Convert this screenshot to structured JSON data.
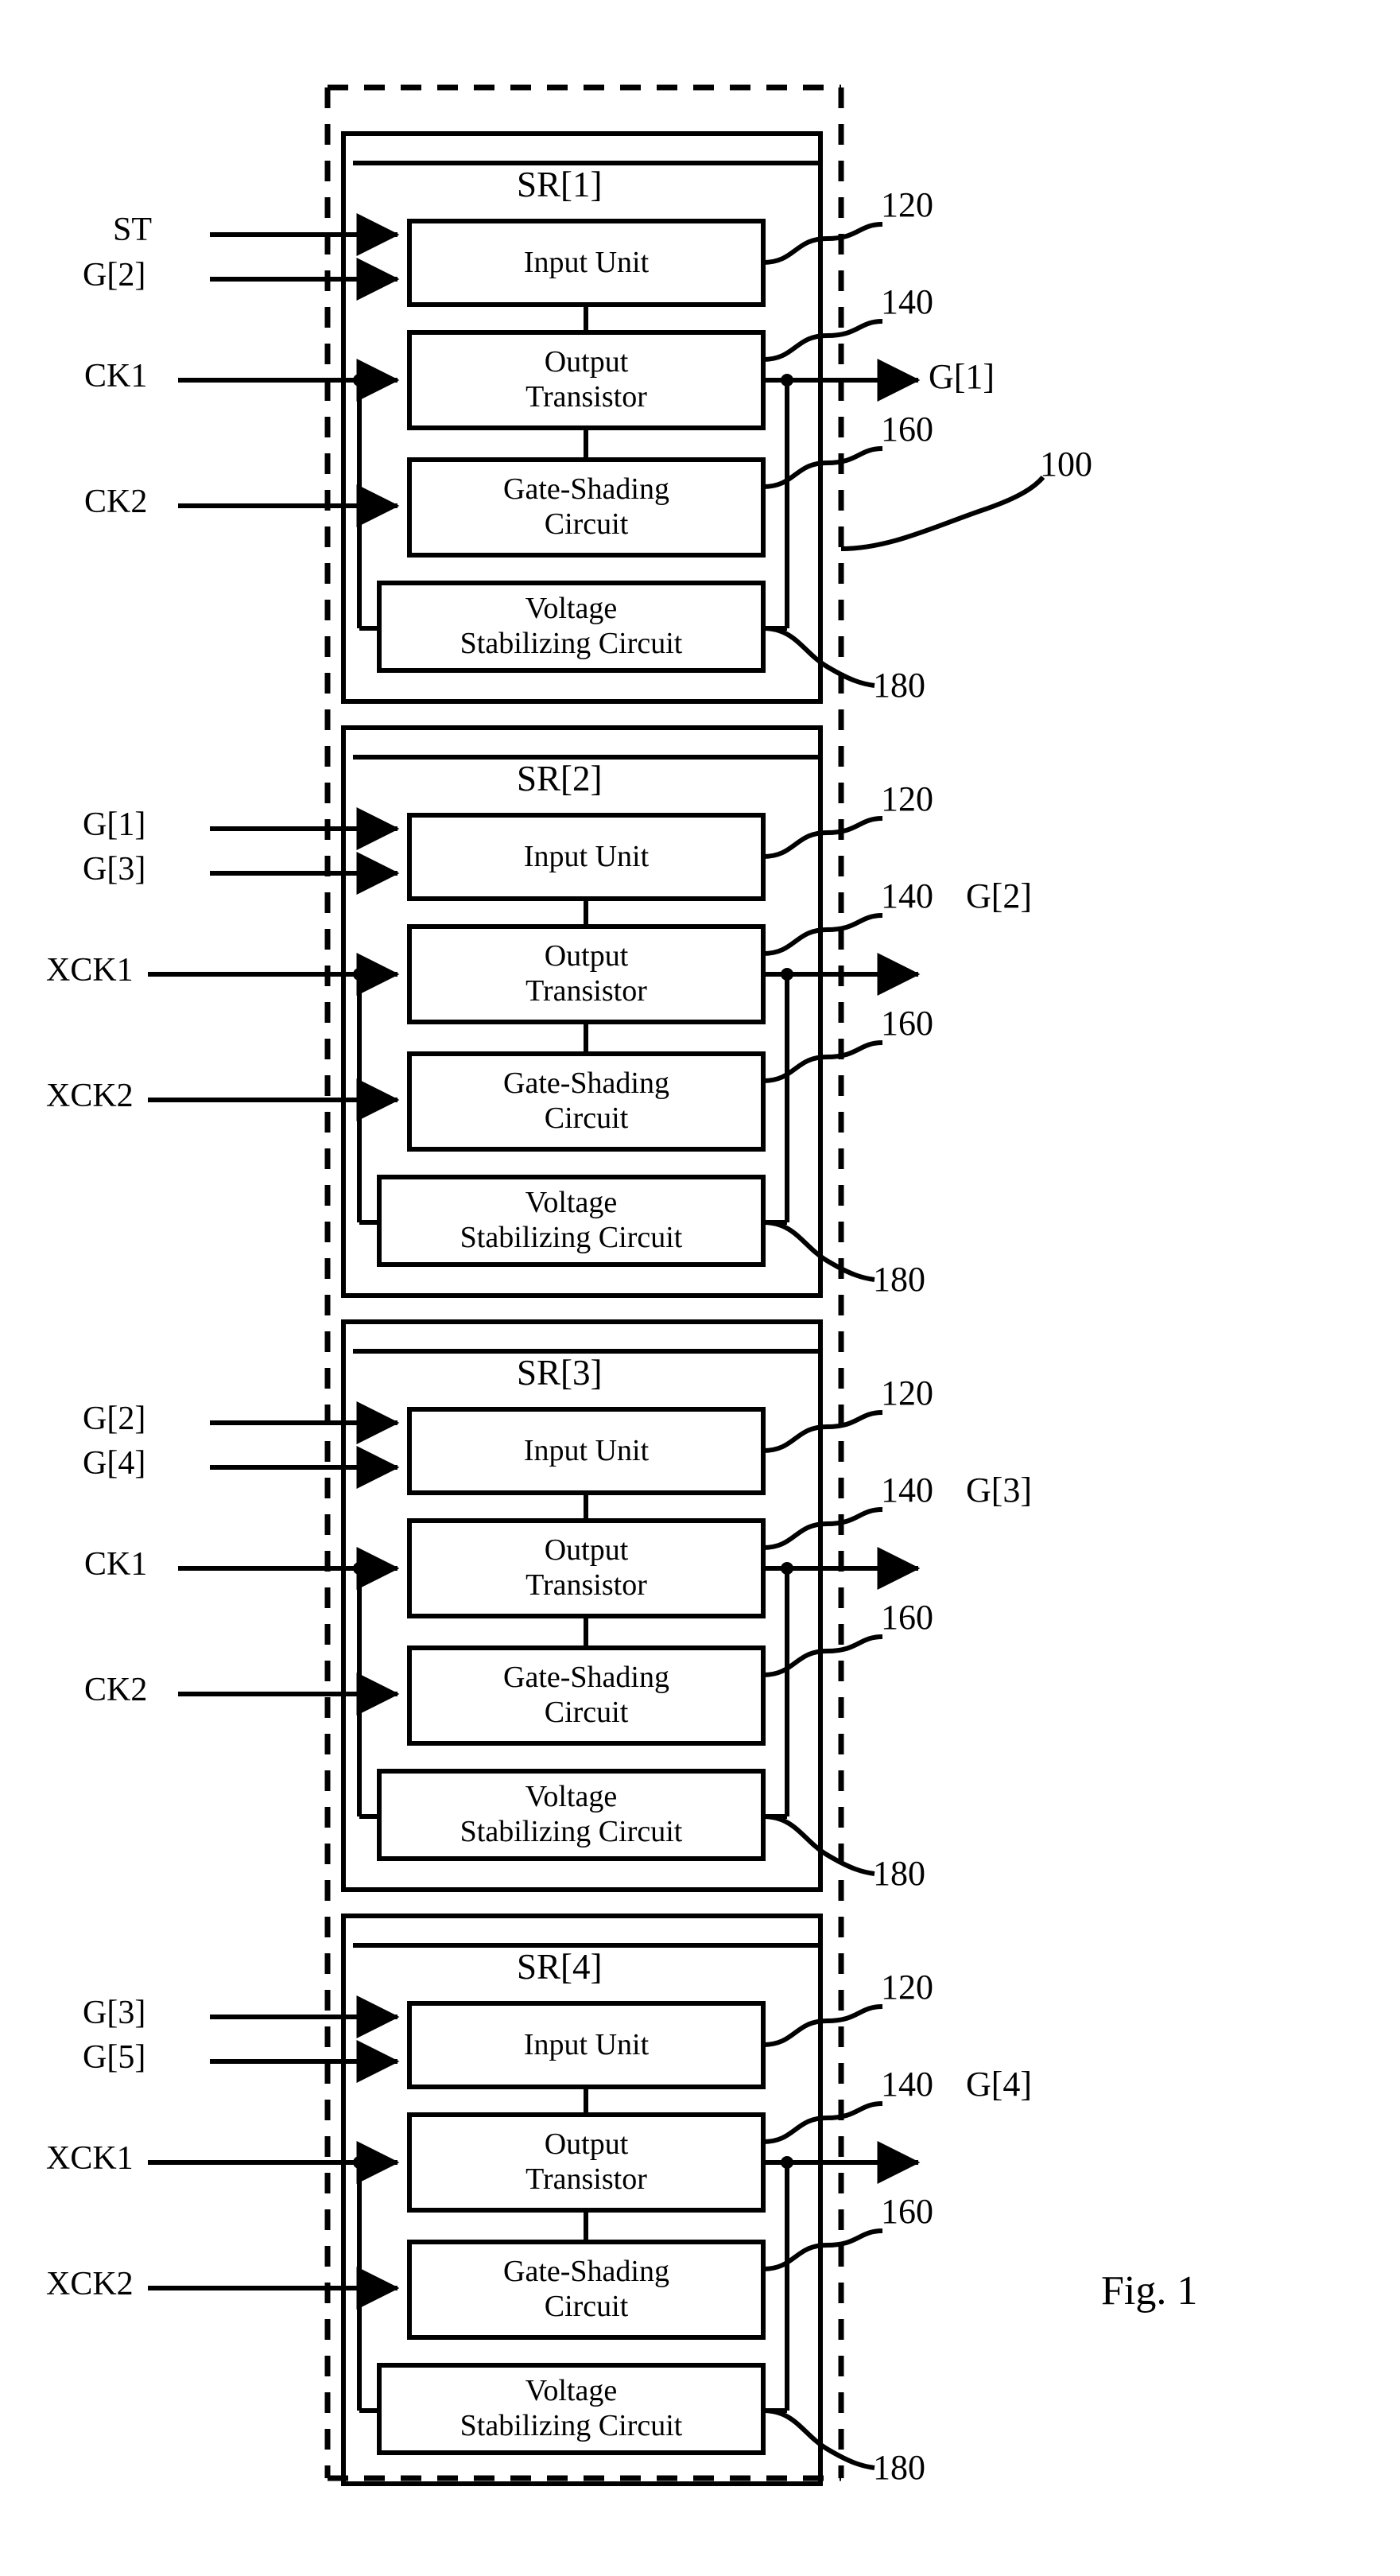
{
  "figure": {
    "caption": "Fig. 1",
    "outer_ref": "100",
    "block_refs": {
      "input_unit": "120",
      "output_transistor": "140",
      "gate_shading": "160",
      "voltage_stabilizing": "180"
    },
    "unit_labels": {
      "input_unit": "Input Unit",
      "output_transistor_line1": "Output",
      "output_transistor_line2": "Transistor",
      "gate_shading_line1": "Gate-Shading",
      "gate_shading_line2": "Circuit",
      "voltage_line1": "Voltage",
      "voltage_line2": "Stabilizing Circuit"
    },
    "stages": [
      {
        "name": "SR[1]",
        "input_signals": [
          "ST",
          "G[2]"
        ],
        "clock_signal": "CK1",
        "shading_clock": "CK2",
        "output": "G[1]",
        "refs": {
          "input_unit": "120",
          "output_transistor": "140",
          "gate_shading": "160",
          "voltage_stabilizing": "180"
        }
      },
      {
        "name": "SR[2]",
        "input_signals": [
          "G[1]",
          "G[3]"
        ],
        "clock_signal": "XCK1",
        "shading_clock": "XCK2",
        "output": "G[2]",
        "refs": {
          "input_unit": "120",
          "output_transistor": "140",
          "gate_shading": "160",
          "voltage_stabilizing": "180"
        }
      },
      {
        "name": "SR[3]",
        "input_signals": [
          "G[2]",
          "G[4]"
        ],
        "clock_signal": "CK1",
        "shading_clock": "CK2",
        "output": "G[3]",
        "refs": {
          "input_unit": "120",
          "output_transistor": "140",
          "gate_shading": "160",
          "voltage_stabilizing": "180"
        }
      },
      {
        "name": "SR[4]",
        "input_signals": [
          "G[3]",
          "G[5]"
        ],
        "clock_signal": "XCK1",
        "shading_clock": "XCK2",
        "output": "G[4]",
        "refs": {
          "input_unit": "120",
          "output_transistor": "140",
          "gate_shading": "160",
          "voltage_stabilizing": "180"
        }
      }
    ]
  },
  "colors": {
    "ink": "#000000",
    "paper": "#ffffff"
  }
}
